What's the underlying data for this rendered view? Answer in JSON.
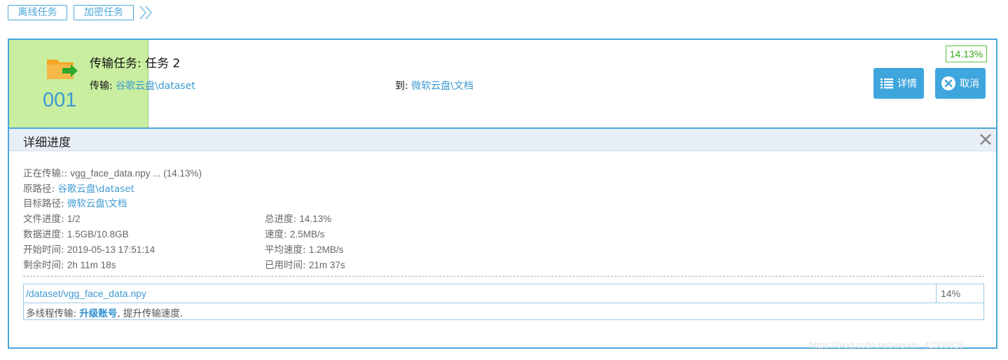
{
  "tabs": [
    {
      "label": "离线任务"
    },
    {
      "label": "加密任务"
    }
  ],
  "task": {
    "progress_percent": 14.13,
    "index": "001",
    "title_prefix": "传输任务: ",
    "title_name": "任务 2",
    "from_label": "传输: ",
    "from_path": "谷歌云盘\\dataset",
    "to_label": "到: ",
    "to_path": "微软云盘\\文档",
    "percent_badge": "14.13%",
    "detail_button": "详情",
    "cancel_button": "取消"
  },
  "detail": {
    "title": "详细进度",
    "transferring_label": "正在传输:: ",
    "transferring_value": "vgg_face_data.npy ... (14.13%)",
    "source_label": "原路径: ",
    "source_value": "谷歌云盘\\dataset",
    "target_label": "目标路径: ",
    "target_value": "微软云盘\\文档",
    "file_progress_label": "文件进度: ",
    "file_progress_value": "1/2",
    "total_progress_label": "总进度: ",
    "total_progress_value": "14.13%",
    "data_progress_label": "数据进度: ",
    "data_progress_value": "1.5GB/10.8GB",
    "speed_label": "速度: ",
    "speed_value": "2.5MB/s",
    "start_time_label": "开始时间: ",
    "start_time_value": "2019-05-13 17:51:14",
    "avg_speed_label": "平均速度: ",
    "avg_speed_value": "1.2MB/s",
    "remaining_label": "剩余时间: ",
    "remaining_value": "2h 11m 18s",
    "elapsed_label": "已用时间: ",
    "elapsed_value": "21m 37s",
    "file_path": "/dataset/vgg_face_data.npy",
    "file_percent": "14%",
    "tip_prefix": "多线程传输: ",
    "tip_link": "升级账号",
    "tip_suffix": ", 提升传输速度."
  },
  "watermark": "https://blog.csdn.net/weixin_42509626",
  "colors": {
    "accent": "#3fa6dd",
    "progress": "#c9eea0",
    "badge": "#3aa51e",
    "folder": "#f5a623",
    "arrow": "#2ea829"
  },
  "icons": [
    "double-chevron-icon",
    "folder-arrow-icon",
    "list-icon",
    "cancel-circle-icon",
    "close-icon"
  ]
}
